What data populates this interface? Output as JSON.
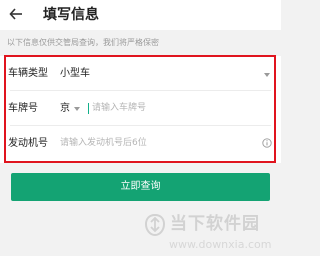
{
  "header": {
    "title": "填写信息",
    "back_icon": "arrow-left-icon"
  },
  "privacy_note": "以下信息仅供交管局查询，我们将严格保密",
  "form": {
    "vehicle_type": {
      "label": "车辆类型",
      "value": "小型车"
    },
    "plate_number": {
      "label": "车牌号",
      "prefix": "京",
      "placeholder": "请输入车牌号"
    },
    "engine_number": {
      "label": "发动机号",
      "placeholder": "请输入发动机号后6位",
      "info_icon": "info-circle-icon"
    }
  },
  "submit_label": "立即查询",
  "watermark": {
    "brand": "当下软件园",
    "url": "www.downxia.com"
  },
  "colors": {
    "accent_green": "#14a373",
    "highlight_red": "#e0141e",
    "cursor_green": "#12b08a"
  }
}
